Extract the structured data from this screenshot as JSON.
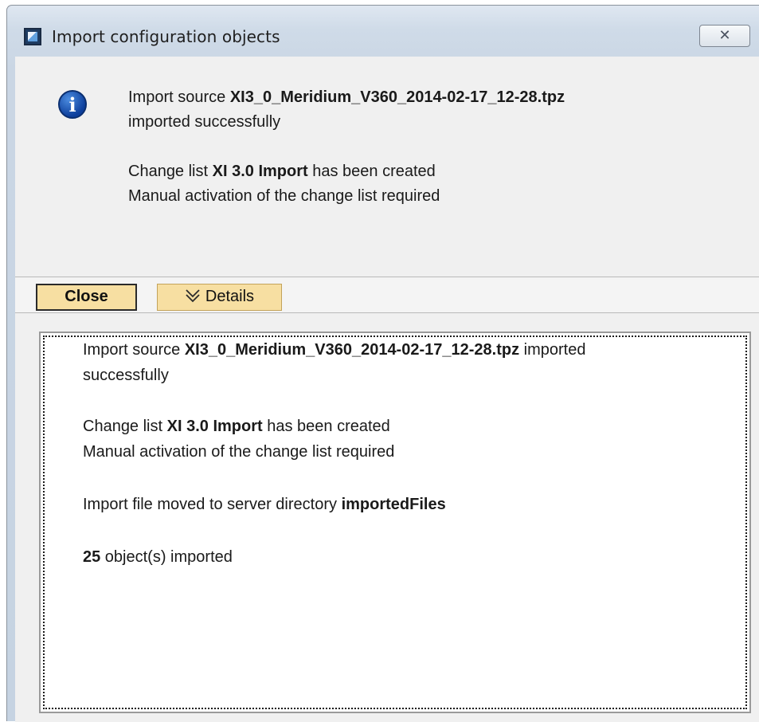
{
  "window": {
    "title": "Import configuration objects",
    "close_symbol": "✕",
    "icon": "app-window-icon"
  },
  "message": {
    "icon": "info-icon",
    "icon_glyph": "i",
    "line1_prefix": "Import source ",
    "source_file": "XI3_0_Meridium_V360_2014-02-17_12-28.tpz",
    "line1_suffix": "imported successfully",
    "line2_prefix": "Change list ",
    "change_list": "XI 3.0 Import",
    "line2_suffix": " has been created",
    "line3": "Manual activation of the change list required"
  },
  "buttons": {
    "close_label": "Close",
    "details_label": "Details",
    "details_icon": "double-chevron-down-icon"
  },
  "details": {
    "line1_prefix": "Import source ",
    "source_file": "XI3_0_Meridium_V360_2014-02-17_12-28.tpz",
    "line1_suffix": " imported",
    "line1_wrap": "successfully",
    "line2_prefix": "Change list ",
    "change_list": "XI 3.0 Import",
    "line2_suffix": " has been created",
    "line3": "Manual activation of the change list required",
    "line4_prefix": "Import file moved to server directory ",
    "directory": "importedFiles",
    "count": "25",
    "count_suffix": " object(s) imported"
  },
  "colors": {
    "button_fill": "#f7dfa2",
    "info_blue": "#0d3f9c",
    "title_gradient": "#cfdbe8"
  }
}
